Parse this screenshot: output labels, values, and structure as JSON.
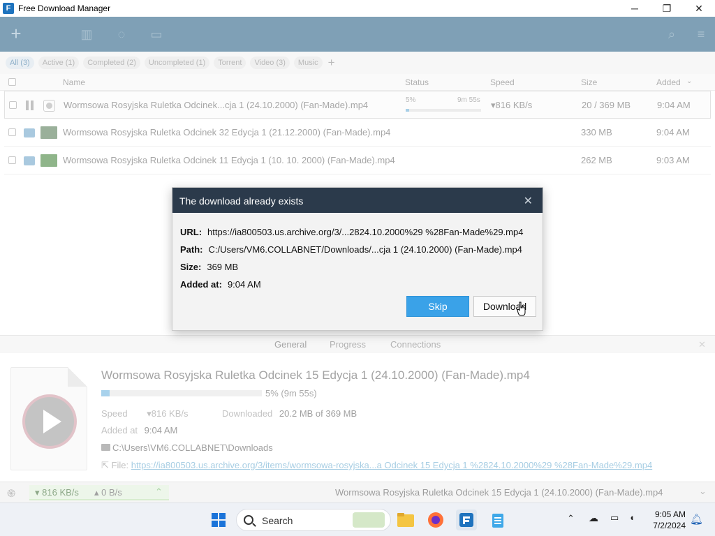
{
  "window": {
    "title": "Free Download Manager",
    "controls": [
      "─",
      "❐",
      "✕"
    ]
  },
  "filters": [
    {
      "label": "All (3)",
      "active": true
    },
    {
      "label": "Active (1)"
    },
    {
      "label": "Completed (2)"
    },
    {
      "label": "Uncompleted (1)"
    },
    {
      "label": "Torrent"
    },
    {
      "label": "Video (3)"
    },
    {
      "label": "Music"
    }
  ],
  "table": {
    "headers": {
      "name": "Name",
      "status": "Status",
      "speed": "Speed",
      "size": "Size",
      "added": "Added"
    },
    "rows": [
      {
        "name": "Wormsowa Rosyjska Ruletka Odcinek...cja 1 (24.10.2000) (Fan-Made).mp4",
        "status_pct": "5%",
        "status_eta": "9m 55s",
        "progress": 0.05,
        "speed": "▾816 KB/s",
        "size": "20 / 369 MB",
        "added": "9:04 AM"
      },
      {
        "name": "Wormsowa Rosyjska Ruletka Odcinek 32 Edycja 1 (21.12.2000) (Fan-Made).mp4",
        "size": "330 MB",
        "added": "9:04 AM"
      },
      {
        "name": "Wormsowa Rosyjska Ruletka Odcinek 11 Edycja 1 (10. 10. 2000) (Fan-Made).mp4",
        "size": "262 MB",
        "added": "9:03 AM"
      }
    ]
  },
  "dialog": {
    "title": "The download already exists",
    "url_label": "URL:",
    "url": "https://ia800503.us.archive.org/3/...2824.10.2000%29 %28Fan-Made%29.mp4",
    "path_label": "Path:",
    "path": "C:/Users/VM6.COLLABNET/Downloads/...cja 1 (24.10.2000) (Fan-Made).mp4",
    "size_label": "Size:",
    "size": "369 MB",
    "added_label": "Added at:",
    "added": "9:04 AM",
    "skip": "Skip",
    "download": "Download"
  },
  "details": {
    "tabs": [
      "General",
      "Progress",
      "Connections"
    ],
    "title": "Wormsowa Rosyjska Ruletka Odcinek 15 Edycja 1 (24.10.2000) (Fan-Made).mp4",
    "progress_text": "5% (9m 55s)",
    "progress": 0.05,
    "speed_label": "Speed",
    "speed": "▾816 KB/s",
    "downloaded_label": "Downloaded",
    "downloaded": "20.2 MB of 369 MB",
    "added_label": "Added at",
    "added": "9:04 AM",
    "folder": "C:\\Users\\VM6.COLLABNET\\Downloads",
    "file_label": "File:",
    "file_link": "https://ia800503.us.archive.org/3/items/wormsowa-rosyjska...a Odcinek 15 Edycja 1 %2824.10.2000%29 %28Fan-Made%29.mp4"
  },
  "statusbar": {
    "down": "▾ 816 KB/s",
    "up": "▴ 0 B/s",
    "current": "Wormsowa Rosyjska Ruletka Odcinek 15 Edycja 1 (24.10.2000) (Fan-Made).mp4"
  },
  "taskbar": {
    "search": "Search",
    "time": "9:05 AM",
    "date": "7/2/2024"
  }
}
